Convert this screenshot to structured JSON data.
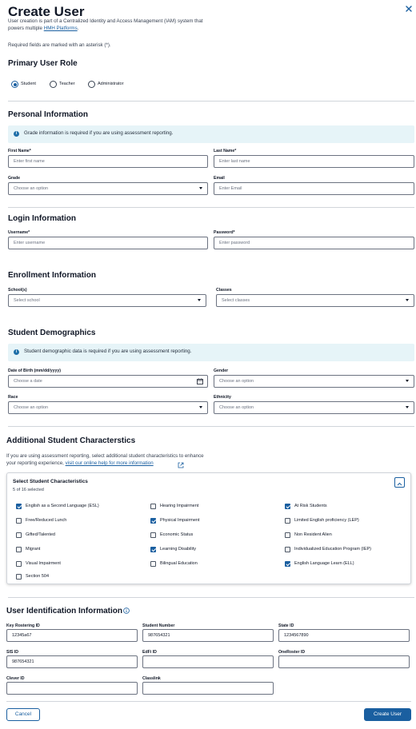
{
  "header": {
    "title": "Create User",
    "description_pre": "User creation is part of a Centralized Identity and Access Management (IAM) system that",
    "description_line2": "powers multiple",
    "platforms_link": "HMH Platforms",
    "period": ".",
    "required_note": "Required fields are marked with an asterisk (*)."
  },
  "role": {
    "title": "Primary User Role",
    "options": [
      {
        "label": "Student",
        "selected": true
      },
      {
        "label": "Teacher",
        "selected": false
      },
      {
        "label": "Administrator",
        "selected": false
      }
    ]
  },
  "personal": {
    "title": "Personal Information",
    "info": "Grade information is required if you are using assessment reporting.",
    "first_name_label": "First Name*",
    "first_name_placeholder": "Enter first name",
    "last_name_label": "Last Name*",
    "last_name_placeholder": "Enter last name",
    "grade_label": "Grade",
    "grade_placeholder": "Choose an option",
    "email_label": "Email",
    "email_placeholder": "Enter Email"
  },
  "login": {
    "title": "Login Information",
    "username_label": "Username*",
    "username_placeholder": "Enter username",
    "password_label": "Password*",
    "password_placeholder": "Enter password"
  },
  "enrollment": {
    "title": "Enrollment Information",
    "school_label": "School(s)",
    "school_placeholder": "Select school",
    "classes_label": "Classes",
    "classes_placeholder": "Select classes"
  },
  "demographics": {
    "title": "Student Demographics",
    "info": "Student demographic data is required if you are using assessment reporting.",
    "dob_label": "Date of Birth (mm/dd/yyyy)",
    "dob_placeholder": "Choose a date",
    "gender_label": "Gender",
    "gender_placeholder": "Choose an option",
    "race_label": "Race",
    "race_placeholder": "Choose an option",
    "ethnicity_label": "Ethnicity",
    "ethnicity_placeholder": "Choose an option"
  },
  "characteristics": {
    "title": "Additional Student Characterstics",
    "desc_line1": "If you are using assessment reporting, select additional student characteristics to enhance",
    "desc_line2": "your reporting experience,",
    "help_link": "visit our online help for more information",
    "panel_title": "Select Student Characteristics",
    "selected_count": "5 of 16 selected",
    "items": [
      {
        "label": "English as a Second Language (ESL)",
        "checked": true
      },
      {
        "label": "Hearing Impairment",
        "checked": false
      },
      {
        "label": "At Risk Students",
        "checked": true
      },
      {
        "label": "Free/Reduced Lunch",
        "checked": false
      },
      {
        "label": "Physical Impairment",
        "checked": true
      },
      {
        "label": "Limited English proficiency (LEP)",
        "checked": false
      },
      {
        "label": "Gifted/Talented",
        "checked": false
      },
      {
        "label": "Economic Status",
        "checked": false
      },
      {
        "label": "Non Resident Alien",
        "checked": false
      },
      {
        "label": "Migrant",
        "checked": false
      },
      {
        "label": "Learning Disability",
        "checked": true
      },
      {
        "label": "Individualized Education Program (IEP)",
        "checked": false
      },
      {
        "label": "Visual Impairment",
        "checked": false
      },
      {
        "label": "Bilingual Education",
        "checked": false
      },
      {
        "label": "English Language Learn (ELL)",
        "checked": true
      },
      {
        "label": "Section 504",
        "checked": false
      }
    ]
  },
  "identification": {
    "title": "User Identification Information",
    "fields": [
      {
        "label": "Key Rostering ID",
        "value": "12345a67"
      },
      {
        "label": "Student Number",
        "value": "987654321"
      },
      {
        "label": "State ID",
        "value": "1234567890"
      },
      {
        "label": "SIS ID",
        "value": "987654321"
      },
      {
        "label": "EdFi ID",
        "value": ""
      },
      {
        "label": "OneRoster ID",
        "value": ""
      },
      {
        "label": "Clever ID",
        "value": ""
      },
      {
        "label": "Classlink",
        "value": ""
      }
    ]
  },
  "footer": {
    "cancel": "Cancel",
    "create": "Create User"
  },
  "colors": {
    "primary": "#1a5fa0",
    "info_bg": "#e6f4f8"
  }
}
